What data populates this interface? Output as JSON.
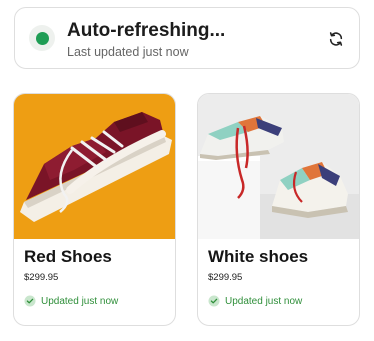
{
  "status": {
    "title": "Auto-refreshing...",
    "subtitle": "Last updated just now",
    "indicator_color": "#1f9d55",
    "refresh_icon": "refresh-icon"
  },
  "products": [
    {
      "name": "Red Shoes",
      "price": "$299.95",
      "updated": "Updated just now",
      "image_background": "#f2a416",
      "shoe_color": "#7a1427"
    },
    {
      "name": "White shoes",
      "price": "$299.95",
      "updated": "Updated just now",
      "image_background": "#e9e9e9",
      "shoe_color": "#f1f1ee"
    }
  ],
  "colors": {
    "success_green": "#2f8f3a",
    "border": "#dedede"
  }
}
